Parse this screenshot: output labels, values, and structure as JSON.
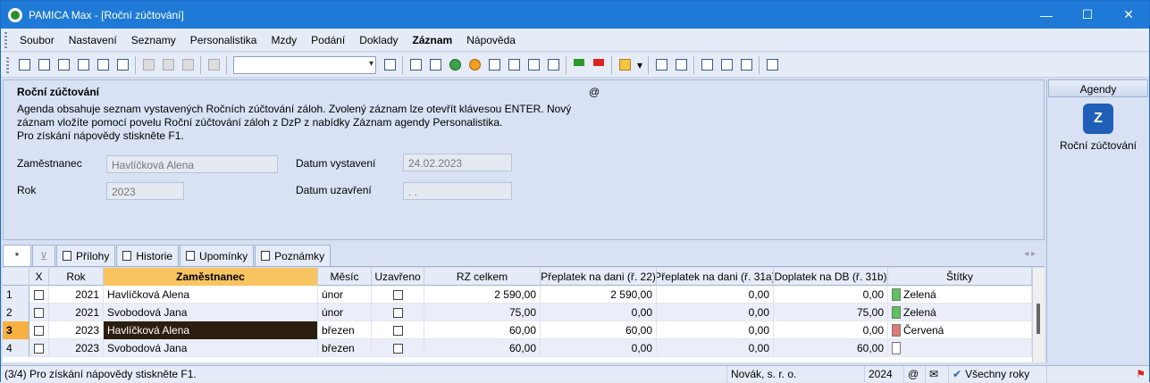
{
  "window": {
    "title": "PAMICA Max - [Roční zúčtování]",
    "min": "—",
    "max": "☐",
    "close": "✕"
  },
  "menu": [
    {
      "label": "Soubor"
    },
    {
      "label": "Nastavení"
    },
    {
      "label": "Seznamy"
    },
    {
      "label": "Personalistika"
    },
    {
      "label": "Mzdy"
    },
    {
      "label": "Podání"
    },
    {
      "label": "Doklady"
    },
    {
      "label": "Záznam"
    },
    {
      "label": "Nápověda"
    }
  ],
  "form": {
    "title": "Roční zúčtování",
    "at": "@",
    "description": "Agenda obsahuje seznam vystavených Ročních zúčtování záloh. Zvolený záznam lze otevřít klávesou ENTER. Nový záznam vložíte pomocí povelu Roční zúčtování záloh z DzP z nabídky Záznam agendy Personalistika.",
    "help": "Pro získání nápovědy stiskněte F1.",
    "employee_label": "Zaměstnanec",
    "employee_value": "Havlíčková Alena",
    "year_label": "Rok",
    "year_value": "2023",
    "issued_label": "Datum vystavení",
    "issued_value": "24.02.2023",
    "closed_label": "Datum uzavření",
    "closed_value": " .  ."
  },
  "agendas": {
    "header": "Agendy",
    "item": "Roční zúčtování",
    "icon": "Z"
  },
  "tabs": [
    {
      "label": "*"
    },
    {
      "label": "Přílohy"
    },
    {
      "label": "Historie"
    },
    {
      "label": "Upomínky"
    },
    {
      "label": "Poznámky"
    }
  ],
  "nav_arrows": "◂ ▸",
  "table": {
    "headers": [
      "X",
      "Rok",
      "Zaměstnanec",
      "Měsíc",
      "Uzavřeno",
      "RZ celkem",
      "Přeplatek na dani (ř. 22)",
      "Přeplatek na dani (ř. 31a)",
      "Doplatek na DB (ř. 31b)",
      "Štítky"
    ],
    "rows": [
      {
        "n": "1",
        "rok": "2021",
        "name": "Havlíčková Alena",
        "mesic": "únor",
        "rz": "2 590,00",
        "p22": "2 590,00",
        "p31a": "0,00",
        "d31b": "0,00",
        "tag": "Zelená",
        "tagcolor": "#5cc45c"
      },
      {
        "n": "2",
        "rok": "2021",
        "name": "Svobodová Jana",
        "mesic": "únor",
        "rz": "75,00",
        "p22": "0,00",
        "p31a": "0,00",
        "d31b": "75,00",
        "tag": "Zelená",
        "tagcolor": "#5cc45c"
      },
      {
        "n": "3",
        "rok": "2023",
        "name": "Havlíčková Alena",
        "mesic": "březen",
        "rz": "60,00",
        "p22": "60,00",
        "p31a": "0,00",
        "d31b": "0,00",
        "tag": "Červená",
        "tagcolor": "#e07a7a"
      },
      {
        "n": "4",
        "rok": "2023",
        "name": "Svobodová Jana",
        "mesic": "březen",
        "rz": "60,00",
        "p22": "0,00",
        "p31a": "0,00",
        "d31b": "60,00",
        "tag": "",
        "tagcolor": "#ffffff"
      }
    ]
  },
  "status": {
    "message": "(3/4) Pro získání nápovědy stiskněte F1.",
    "company": "Novák, s. r. o.",
    "year": "2024",
    "at": "@",
    "all_years": "Všechny roky"
  }
}
